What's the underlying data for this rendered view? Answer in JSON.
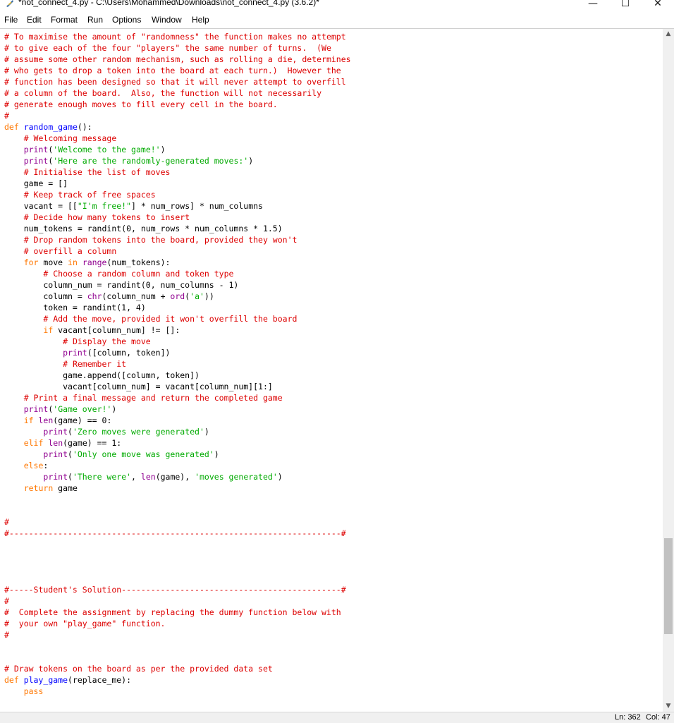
{
  "window": {
    "title": "*not_connect_4.py - C:\\Users\\Mohammed\\Downloads\\not_connect_4.py (3.6.2)*",
    "minimize": "—",
    "maximize": "☐",
    "close": "✕"
  },
  "menu": [
    "File",
    "Edit",
    "Format",
    "Run",
    "Options",
    "Window",
    "Help"
  ],
  "icons": {
    "app": "python-feather-icon",
    "scroll_up": "chevron-up-icon",
    "scroll_down": "chevron-down-icon"
  },
  "colors": {
    "comment": "#dd0000",
    "keyword": "#ff7700",
    "string": "#00aa00",
    "builtin": "#900090",
    "definition": "#0000ff"
  },
  "code_lines": [
    [
      [
        "c",
        "# To maximise the amount of \"randomness\" the function makes no attempt"
      ]
    ],
    [
      [
        "c",
        "# to give each of the four \"players\" the same number of turns.  (We"
      ]
    ],
    [
      [
        "c",
        "# assume some other random mechanism, such as rolling a die, determines"
      ]
    ],
    [
      [
        "c",
        "# who gets to drop a token into the board at each turn.)  However the"
      ]
    ],
    [
      [
        "c",
        "# function has been designed so that it will never attempt to overfill"
      ]
    ],
    [
      [
        "c",
        "# a column of the board.  Also, the function will not necessarily"
      ]
    ],
    [
      [
        "c",
        "# generate enough moves to fill every cell in the board."
      ]
    ],
    [
      [
        "c",
        "#"
      ]
    ],
    [
      [
        "k",
        "def "
      ],
      [
        "d",
        "random_game"
      ],
      [
        "",
        "():"
      ]
    ],
    [
      [
        "",
        "    "
      ],
      [
        "c",
        "# Welcoming message"
      ]
    ],
    [
      [
        "",
        "    "
      ],
      [
        "b",
        "print"
      ],
      [
        "",
        "("
      ],
      [
        "s",
        "'Welcome to the game!'"
      ],
      [
        "",
        ")"
      ]
    ],
    [
      [
        "",
        "    "
      ],
      [
        "b",
        "print"
      ],
      [
        "",
        "("
      ],
      [
        "s",
        "'Here are the randomly-generated moves:'"
      ],
      [
        "",
        ")"
      ]
    ],
    [
      [
        "",
        "    "
      ],
      [
        "c",
        "# Initialise the list of moves"
      ]
    ],
    [
      [
        "",
        "    game = []"
      ]
    ],
    [
      [
        "",
        "    "
      ],
      [
        "c",
        "# Keep track of free spaces"
      ]
    ],
    [
      [
        "",
        "    vacant = [["
      ],
      [
        "s",
        "\"I'm free!\""
      ],
      [
        "",
        "] * num_rows] * num_columns"
      ]
    ],
    [
      [
        "",
        "    "
      ],
      [
        "c",
        "# Decide how many tokens to insert"
      ]
    ],
    [
      [
        "",
        "    num_tokens = randint(0, num_rows * num_columns * 1.5)"
      ]
    ],
    [
      [
        "",
        "    "
      ],
      [
        "c",
        "# Drop random tokens into the board, provided they won't"
      ]
    ],
    [
      [
        "",
        "    "
      ],
      [
        "c",
        "# overfill a column"
      ]
    ],
    [
      [
        "",
        "    "
      ],
      [
        "k",
        "for"
      ],
      [
        "",
        " move "
      ],
      [
        "k",
        "in"
      ],
      [
        "",
        " "
      ],
      [
        "b",
        "range"
      ],
      [
        "",
        "(num_tokens):"
      ]
    ],
    [
      [
        "",
        "        "
      ],
      [
        "c",
        "# Choose a random column and token type"
      ]
    ],
    [
      [
        "",
        "        column_num = randint(0, num_columns - 1)"
      ]
    ],
    [
      [
        "",
        "        column = "
      ],
      [
        "b",
        "chr"
      ],
      [
        "",
        "(column_num + "
      ],
      [
        "b",
        "ord"
      ],
      [
        "",
        "("
      ],
      [
        "s",
        "'a'"
      ],
      [
        "",
        "))"
      ]
    ],
    [
      [
        "",
        "        token = randint(1, 4)"
      ]
    ],
    [
      [
        "",
        "        "
      ],
      [
        "c",
        "# Add the move, provided it won't overfill the board"
      ]
    ],
    [
      [
        "",
        "        "
      ],
      [
        "k",
        "if"
      ],
      [
        "",
        " vacant[column_num] != []:"
      ]
    ],
    [
      [
        "",
        "            "
      ],
      [
        "c",
        "# Display the move"
      ]
    ],
    [
      [
        "",
        "            "
      ],
      [
        "b",
        "print"
      ],
      [
        "",
        "([column, token])"
      ]
    ],
    [
      [
        "",
        "            "
      ],
      [
        "c",
        "# Remember it"
      ]
    ],
    [
      [
        "",
        "            game.append([column, token])"
      ]
    ],
    [
      [
        "",
        "            vacant[column_num] = vacant[column_num][1:]"
      ]
    ],
    [
      [
        "",
        "    "
      ],
      [
        "c",
        "# Print a final message and return the completed game"
      ]
    ],
    [
      [
        "",
        "    "
      ],
      [
        "b",
        "print"
      ],
      [
        "",
        "("
      ],
      [
        "s",
        "'Game over!'"
      ],
      [
        "",
        ")"
      ]
    ],
    [
      [
        "",
        "    "
      ],
      [
        "k",
        "if"
      ],
      [
        "",
        " "
      ],
      [
        "b",
        "len"
      ],
      [
        "",
        "(game) == 0:"
      ]
    ],
    [
      [
        "",
        "        "
      ],
      [
        "b",
        "print"
      ],
      [
        "",
        "("
      ],
      [
        "s",
        "'Zero moves were generated'"
      ],
      [
        "",
        ")"
      ]
    ],
    [
      [
        "",
        "    "
      ],
      [
        "k",
        "elif"
      ],
      [
        "",
        " "
      ],
      [
        "b",
        "len"
      ],
      [
        "",
        "(game) == 1:"
      ]
    ],
    [
      [
        "",
        "        "
      ],
      [
        "b",
        "print"
      ],
      [
        "",
        "("
      ],
      [
        "s",
        "'Only one move was generated'"
      ],
      [
        "",
        ")"
      ]
    ],
    [
      [
        "",
        "    "
      ],
      [
        "k",
        "else"
      ],
      [
        "",
        ":"
      ]
    ],
    [
      [
        "",
        "        "
      ],
      [
        "b",
        "print"
      ],
      [
        "",
        "("
      ],
      [
        "s",
        "'There were'"
      ],
      [
        "",
        ", "
      ],
      [
        "b",
        "len"
      ],
      [
        "",
        "(game), "
      ],
      [
        "s",
        "'moves generated'"
      ],
      [
        "",
        ")"
      ]
    ],
    [
      [
        "",
        "    "
      ],
      [
        "k",
        "return"
      ],
      [
        "",
        " game"
      ]
    ],
    [],
    [],
    [
      [
        "c",
        "#"
      ]
    ],
    [
      [
        "c",
        "#--------------------------------------------------------------------#"
      ]
    ],
    [],
    [],
    [],
    [],
    [
      [
        "c",
        "#-----Student's Solution---------------------------------------------#"
      ]
    ],
    [
      [
        "c",
        "#"
      ]
    ],
    [
      [
        "c",
        "#  Complete the assignment by replacing the dummy function below with"
      ]
    ],
    [
      [
        "c",
        "#  your own \"play_game\" function."
      ]
    ],
    [
      [
        "c",
        "#"
      ]
    ],
    [],
    [],
    [
      [
        "c",
        "# Draw tokens on the board as per the provided data set"
      ]
    ],
    [
      [
        "k",
        "def "
      ],
      [
        "d",
        "play_game"
      ],
      [
        "",
        "(replace_me):"
      ]
    ],
    [
      [
        "",
        "    "
      ],
      [
        "k",
        "pass"
      ]
    ],
    [],
    [],
    [
      [
        "c",
        "#"
      ]
    ],
    [
      [
        "c",
        "#--------------------------------------------------------------------#"
      ]
    ]
  ],
  "status": {
    "line": "Ln: 362",
    "col": "Col: 47"
  }
}
